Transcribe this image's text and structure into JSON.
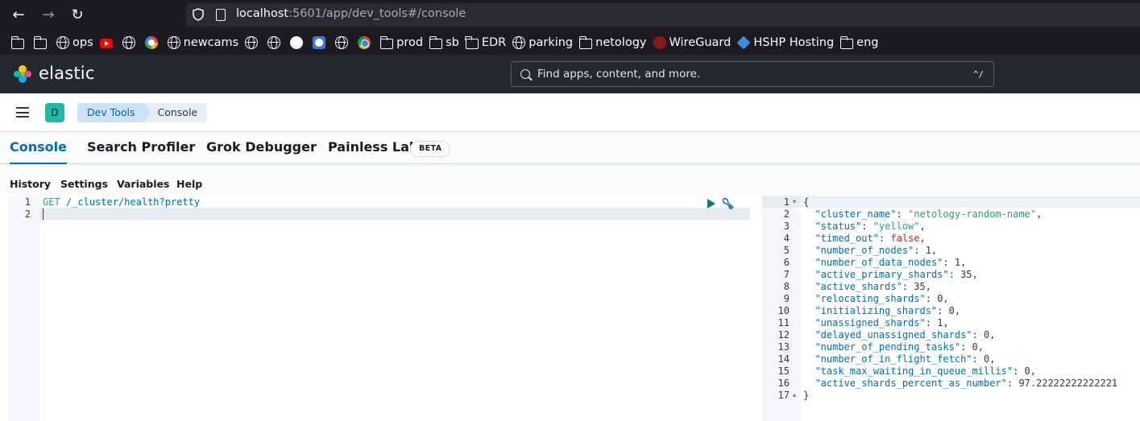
{
  "browser": {
    "url_host": "localhost",
    "url_rest": ":5601/app/dev_tools#/console",
    "bookmarks": [
      {
        "icon": "folder-icon",
        "label": ""
      },
      {
        "icon": "folder-icon",
        "label": ""
      },
      {
        "icon": "globe-icon",
        "label": "ops"
      },
      {
        "icon": "youtube-icon",
        "label": ""
      },
      {
        "icon": "globe-icon",
        "label": ""
      },
      {
        "icon": "google-icon",
        "label": ""
      },
      {
        "icon": "globe-icon",
        "label": "newcams"
      },
      {
        "icon": "globe-icon",
        "label": ""
      },
      {
        "icon": "globe-icon",
        "label": ""
      },
      {
        "icon": "github-icon",
        "label": ""
      },
      {
        "icon": "app-icon",
        "label": ""
      },
      {
        "icon": "globe-icon",
        "label": ""
      },
      {
        "icon": "chrome-icon",
        "label": ""
      },
      {
        "icon": "folder-icon",
        "label": "prod"
      },
      {
        "icon": "folder-icon",
        "label": "sb"
      },
      {
        "icon": "folder-icon",
        "label": "EDR"
      },
      {
        "icon": "globe-icon",
        "label": "parking"
      },
      {
        "icon": "folder-icon",
        "label": "netology"
      },
      {
        "icon": "wireguard-icon",
        "label": "WireGuard"
      },
      {
        "icon": "hshp-icon",
        "label": "HSHP Hosting"
      },
      {
        "icon": "folder-icon",
        "label": "eng"
      }
    ]
  },
  "header": {
    "brand": "elastic",
    "search_placeholder": "Find apps, content, and more.",
    "search_shortcut": "^/"
  },
  "subheader": {
    "space_initial": "D",
    "breadcrumbs": [
      "Dev Tools",
      "Console"
    ]
  },
  "tabs": {
    "console": "Console",
    "search_profiler": "Search Profiler",
    "grok_debugger": "Grok Debugger",
    "painless_lab": "Painless Lab",
    "beta": "BETA"
  },
  "menu": {
    "history": "History",
    "settings": "Settings",
    "variables": "Variables",
    "help": "Help"
  },
  "request": {
    "line_numbers": [
      "1",
      "2"
    ],
    "method": "GET",
    "path": "/_cluster/health?pretty"
  },
  "response": {
    "line_numbers": [
      "1",
      "2",
      "3",
      "4",
      "5",
      "6",
      "7",
      "8",
      "9",
      "10",
      "11",
      "12",
      "13",
      "14",
      "15",
      "16",
      "17"
    ],
    "open_brace": "{",
    "close_brace": "}",
    "fields": [
      {
        "key": "\"cluster_name\"",
        "value": "\"netology-random-name\"",
        "type": "s",
        "comma": ","
      },
      {
        "key": "\"status\"",
        "value": "\"yellow\"",
        "type": "s",
        "comma": ","
      },
      {
        "key": "\"timed_out\"",
        "value": "false",
        "type": "b",
        "comma": ","
      },
      {
        "key": "\"number_of_nodes\"",
        "value": "1",
        "type": "n",
        "comma": ","
      },
      {
        "key": "\"number_of_data_nodes\"",
        "value": "1",
        "type": "n",
        "comma": ","
      },
      {
        "key": "\"active_primary_shards\"",
        "value": "35",
        "type": "n",
        "comma": ","
      },
      {
        "key": "\"active_shards\"",
        "value": "35",
        "type": "n",
        "comma": ","
      },
      {
        "key": "\"relocating_shards\"",
        "value": "0",
        "type": "n",
        "comma": ","
      },
      {
        "key": "\"initializing_shards\"",
        "value": "0",
        "type": "n",
        "comma": ","
      },
      {
        "key": "\"unassigned_shards\"",
        "value": "1",
        "type": "n",
        "comma": ","
      },
      {
        "key": "\"delayed_unassigned_shards\"",
        "value": "0",
        "type": "n",
        "comma": ","
      },
      {
        "key": "\"number_of_pending_tasks\"",
        "value": "0",
        "type": "n",
        "comma": ","
      },
      {
        "key": "\"number_of_in_flight_fetch\"",
        "value": "0",
        "type": "n",
        "comma": ","
      },
      {
        "key": "\"task_max_waiting_in_queue_millis\"",
        "value": "0",
        "type": "n",
        "comma": ","
      },
      {
        "key": "\"active_shards_percent_as_number\"",
        "value": "97.22222222222221",
        "type": "n",
        "comma": ""
      }
    ]
  },
  "colors": {
    "accent": "#006bb8",
    "header_bg": "#25282f",
    "space_avatar": "#1dbaa9"
  }
}
